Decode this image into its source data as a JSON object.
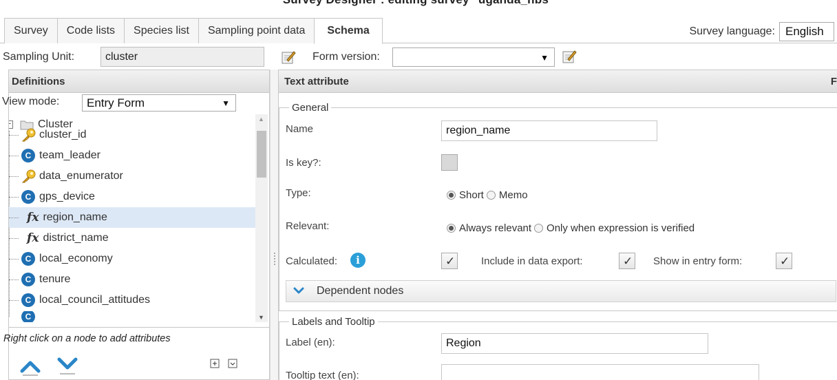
{
  "app": {
    "title": "Survey Designer : editing survey \"uganda_nbs\""
  },
  "tabs": [
    {
      "label": "Survey",
      "active": false
    },
    {
      "label": "Code lists",
      "active": false
    },
    {
      "label": "Species list",
      "active": false
    },
    {
      "label": "Sampling point data",
      "active": false
    },
    {
      "label": "Schema",
      "active": true
    }
  ],
  "language": {
    "label": "Survey language:",
    "value": "English"
  },
  "sampling_unit": {
    "label": "Sampling Unit:",
    "value": "cluster"
  },
  "form_version": {
    "label": "Form version:",
    "value": ""
  },
  "definitions": {
    "title": "Definitions",
    "view_mode_label": "View mode:",
    "view_mode_value": "Entry Form",
    "root": "Cluster",
    "items": [
      {
        "label": "cluster_id",
        "icon": "key-icon"
      },
      {
        "label": "team_leader",
        "icon": "code-attribute-icon"
      },
      {
        "label": "data_enumerator",
        "icon": "key-icon"
      },
      {
        "label": "gps_device",
        "icon": "code-attribute-icon"
      },
      {
        "label": "region_name",
        "icon": "calculated-icon",
        "selected": true
      },
      {
        "label": "district_name",
        "icon": "calculated-icon"
      },
      {
        "label": "local_economy",
        "icon": "code-attribute-icon"
      },
      {
        "label": "tenure",
        "icon": "code-attribute-icon"
      },
      {
        "label": "local_council_attitudes",
        "icon": "code-attribute-icon"
      }
    ],
    "hint": "Right click on a node to add attributes"
  },
  "attribute": {
    "title": "Text attribute",
    "title_right": "F",
    "general_legend": "General",
    "name_label": "Name",
    "name_value": "region_name",
    "is_key_label": "Is key?:",
    "type_label": "Type:",
    "type_options": [
      "Short",
      "Memo"
    ],
    "relevant_label": "Relevant:",
    "relevant_options": [
      "Always relevant",
      "Only when expression is verified"
    ],
    "calculated_label": "Calculated:",
    "include_export_label": "Include in data export:",
    "show_entry_label": "Show in entry form:",
    "dependent_nodes_label": "Dependent nodes",
    "labels_legend": "Labels and Tooltip",
    "label_en_label": "Label (en):",
    "label_en_value": "Region",
    "tooltip_en_label": "Tooltip text (en):",
    "tooltip_en_value": ""
  },
  "colors": {
    "accent": "#1f6fb2",
    "info": "#2a9fd8",
    "selected_row": "#dde8f6"
  }
}
